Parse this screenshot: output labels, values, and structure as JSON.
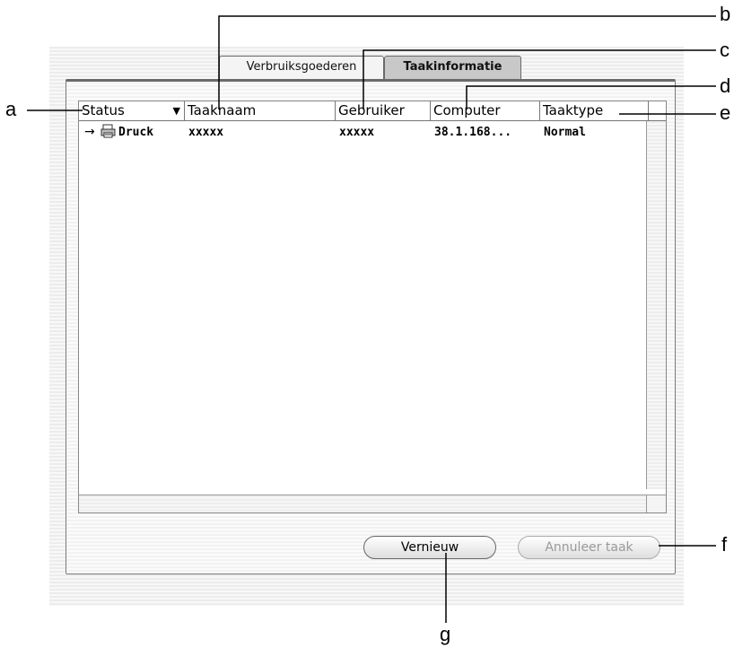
{
  "tabs": [
    {
      "label": "Verbruiksgoederen",
      "active": false
    },
    {
      "label": "Taakinformatie",
      "active": true
    }
  ],
  "table": {
    "columns": [
      "Status",
      "Taaknaam",
      "Gebruiker",
      "Computer",
      "Taaktype"
    ],
    "sort_column": "Status",
    "rows": [
      {
        "status": "Druck",
        "name": "xxxxx",
        "user": "xxxxx",
        "computer": "38.1.168...",
        "type": "Normal"
      }
    ]
  },
  "buttons": {
    "refresh": "Vernieuw",
    "cancel_job": "Annuleer taak"
  },
  "callouts": {
    "a": "a",
    "b": "b",
    "c": "c",
    "d": "d",
    "e": "e",
    "f": "f",
    "g": "g"
  }
}
